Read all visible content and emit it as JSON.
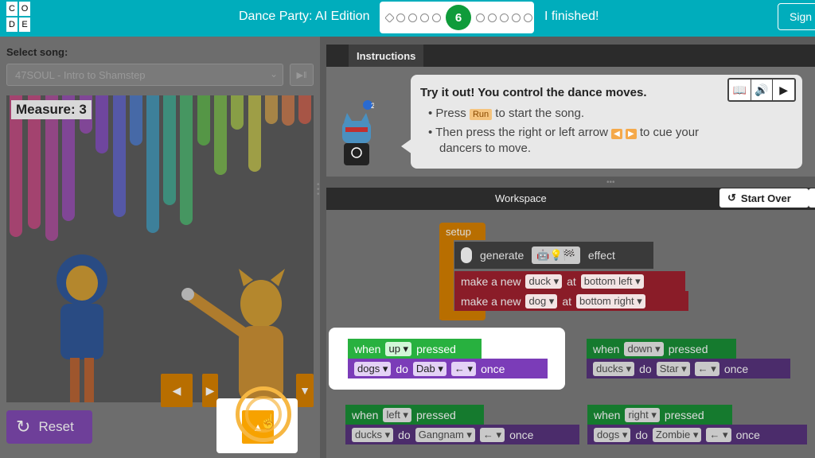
{
  "header": {
    "logo_letters": [
      "C",
      "O",
      "D",
      "E"
    ],
    "level_title": "Dance Party: AI Edition",
    "current_level": "6",
    "finished_label": "I finished!",
    "signin_label": "Sign"
  },
  "left": {
    "select_song_label": "Select song:",
    "song_value": "47SOUL - Intro to Shamstep",
    "measure_label": "Measure: 3",
    "reset_label": "Reset"
  },
  "instructions": {
    "tab_label": "Instructions",
    "title": "Try it out! You control the dance moves.",
    "line1_pre": "• Press",
    "run_tag": "Run",
    "line1_post": "to start the song.",
    "line2_pre": "• Then press the right or left arrow",
    "line2_post": "to cue your",
    "line3": "dancers to move.",
    "badge_count": "2"
  },
  "workspace": {
    "title": "Workspace",
    "start_over_label": "Start Over",
    "setup_label": "setup",
    "generate_label": "generate",
    "effect_label": "effect",
    "make_new_label": "make a new",
    "at_label": "at",
    "block1": {
      "sprite": "duck",
      "location": "bottom left"
    },
    "block2": {
      "sprite": "dog",
      "location": "bottom right"
    },
    "events": [
      {
        "key": "up",
        "sprite": "dogs",
        "move": "Dab",
        "dir": "←",
        "highlighted": true
      },
      {
        "key": "down",
        "sprite": "ducks",
        "move": "Star",
        "dir": "←",
        "highlighted": false
      },
      {
        "key": "left",
        "sprite": "ducks",
        "move": "Gangnam",
        "dir": "←",
        "highlighted": false
      },
      {
        "key": "right",
        "sprite": "dogs",
        "move": "Zombie",
        "dir": "←",
        "highlighted": false
      }
    ],
    "when_label": "when",
    "pressed_label": "pressed",
    "do_label": "do",
    "once_label": "once"
  },
  "colors": {
    "teal": "#00adbc",
    "green_block": "#28b13f",
    "purple_block": "#7b3cb8",
    "orange_button": "#f7a200"
  }
}
